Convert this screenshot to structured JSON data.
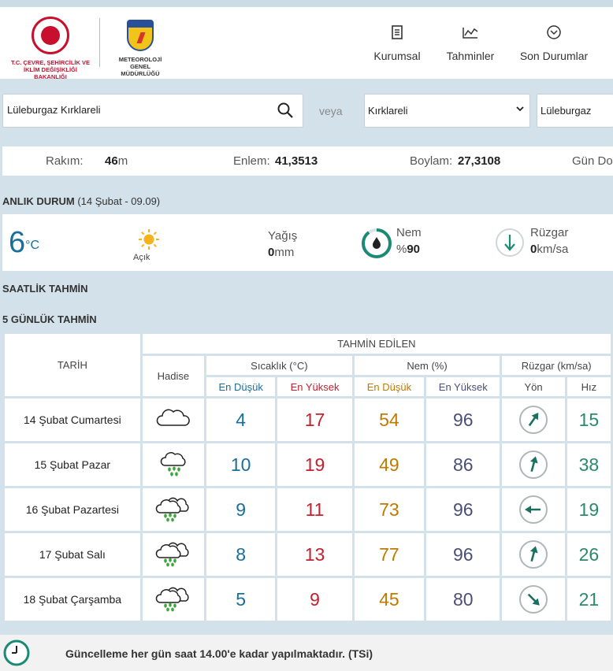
{
  "header": {
    "ministry_logo_text": "T.C. ÇEVRE, ŞEHİRCİLİK VE İKLİM DEĞİŞİKLİĞİ BAKANLIĞI",
    "mgm_logo_text": "METEOROLOJİ GENEL MÜDÜRLÜĞÜ",
    "nav": [
      {
        "label": "Kurumsal",
        "icon": "document-icon"
      },
      {
        "label": "Tahminler",
        "icon": "chart-line-icon"
      },
      {
        "label": "Son Durumlar",
        "icon": "chevron-circle-icon"
      }
    ]
  },
  "search": {
    "value": "Lüleburgaz Kırklareli",
    "or_label": "veya",
    "province": "Kırklareli",
    "district": "Lüleburgaz"
  },
  "station": {
    "rakim_label": "Rakım:",
    "rakim_value": "46",
    "rakim_unit": "m",
    "enlem_label": "Enlem:",
    "enlem_value": "41,3513",
    "boylam_label": "Boylam:",
    "boylam_value": "27,3108",
    "gun_label": "Gün Do"
  },
  "current": {
    "title": "ANLIK DURUM",
    "subtitle": "(14 Şubat - 09.09)",
    "temp": "6",
    "temp_unit": "°C",
    "condition": "Açık",
    "rain_label": "Yağış",
    "rain_value": "0",
    "rain_unit": "mm",
    "humidity_label": "Nem",
    "humidity_prefix": "%",
    "humidity_value": "90",
    "humidity_fraction": 0.9,
    "wind_label": "Rüzgar",
    "wind_value": "0",
    "wind_unit": "km/sa"
  },
  "sections": {
    "hourly": "SAATLİK TAHMİN",
    "daily": "5 GÜNLÜK TAHMİN"
  },
  "forecast": {
    "headers": {
      "date": "TARİH",
      "predicted": "TAHMİN EDİLEN",
      "event": "Hadise",
      "temp": "Sıcaklık (°C)",
      "humidity": "Nem (%)",
      "wind": "Rüzgar (km/sa)",
      "min": "En Düşük",
      "max": "En Yüksek",
      "direction": "Yön",
      "speed": "Hız"
    },
    "rows": [
      {
        "date": "14 Şubat Cumartesi",
        "icon": "cloudy-icon",
        "tmin": "4",
        "tmax": "17",
        "hmin": "54",
        "hmax": "96",
        "wind_dir_deg": 35,
        "wind_speed": "15"
      },
      {
        "date": "15 Şubat Pazar",
        "icon": "rain-icon",
        "tmin": "10",
        "tmax": "19",
        "hmin": "49",
        "hmax": "86",
        "wind_dir_deg": 15,
        "wind_speed": "38"
      },
      {
        "date": "16 Şubat Pazartesi",
        "icon": "cloud-rain-icon",
        "tmin": "9",
        "tmax": "11",
        "hmin": "73",
        "hmax": "96",
        "wind_dir_deg": 270,
        "wind_speed": "19"
      },
      {
        "date": "17 Şubat Salı",
        "icon": "cloud-rain-icon",
        "tmin": "8",
        "tmax": "13",
        "hmin": "77",
        "hmax": "96",
        "wind_dir_deg": 15,
        "wind_speed": "26"
      },
      {
        "date": "18 Şubat Çarşamba",
        "icon": "cloud-rain-icon",
        "tmin": "5",
        "tmax": "9",
        "hmin": "45",
        "hmax": "80",
        "wind_dir_deg": 135,
        "wind_speed": "21"
      }
    ]
  },
  "footer": {
    "text": "Güncelleme her gün saat 14.00'e kadar yapılmaktadır. (TSi)"
  },
  "colors": {
    "accent": "#1a6f9a",
    "min": "#1a6f9a",
    "max": "#c4202e",
    "hum_min": "#c07a00",
    "hum_max": "#4a4f7a",
    "wind": "#2a8a6a"
  }
}
